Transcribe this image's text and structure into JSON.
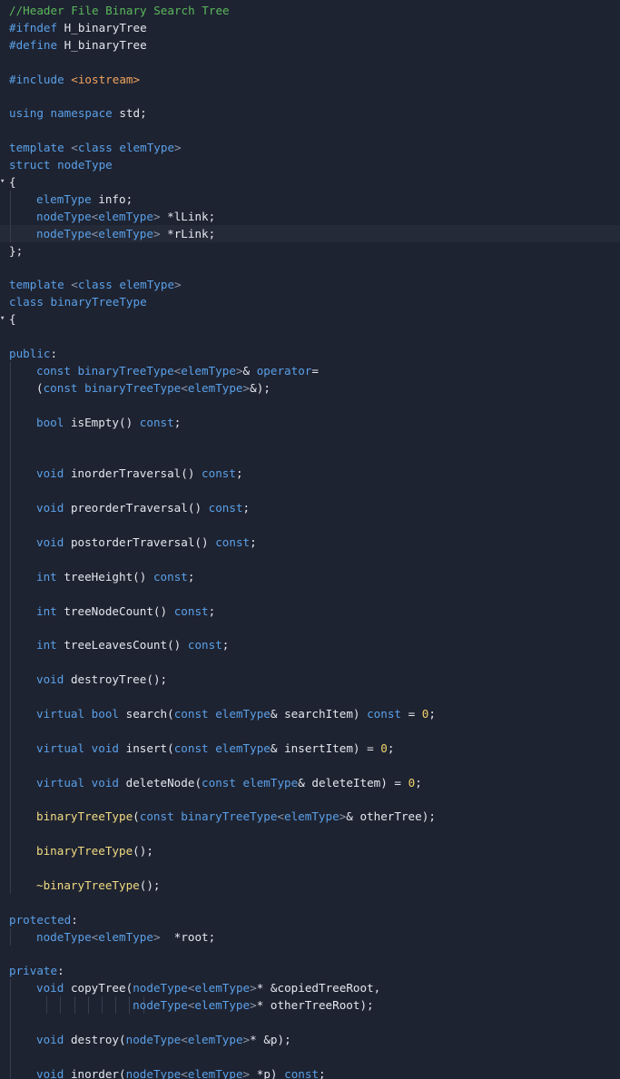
{
  "editor": {
    "lines": [
      {
        "text": "//Header File Binary Search Tree",
        "indent": 0
      },
      {
        "text": "#ifndef H_binaryTree",
        "indent": 0
      },
      {
        "text": "#define H_binaryTree",
        "indent": 0
      },
      {
        "text": "",
        "indent": 0
      },
      {
        "text": "#include <iostream>",
        "indent": 0
      },
      {
        "text": "",
        "indent": 0
      },
      {
        "text": "using namespace std;",
        "indent": 0
      },
      {
        "text": "",
        "indent": 0
      },
      {
        "text": "template <class elemType>",
        "indent": 0
      },
      {
        "text": "struct nodeType",
        "indent": 0
      },
      {
        "text": "{",
        "indent": 0,
        "fold": true
      },
      {
        "text": "elemType info;",
        "indent": 1
      },
      {
        "text": "nodeType<elemType> *lLink;",
        "indent": 1
      },
      {
        "text": "nodeType<elemType> *rLink;",
        "indent": 1,
        "active": true
      },
      {
        "text": "};",
        "indent": 0
      },
      {
        "text": "",
        "indent": 0
      },
      {
        "text": "template <class elemType>",
        "indent": 0
      },
      {
        "text": "class binaryTreeType",
        "indent": 0
      },
      {
        "text": "{",
        "indent": 0,
        "fold": true
      },
      {
        "text": "",
        "indent": 0
      },
      {
        "text": "public:",
        "indent": 0
      },
      {
        "text": "const binaryTreeType<elemType>& operator=",
        "indent": 1
      },
      {
        "text": "(const binaryTreeType<elemType>&);",
        "indent": 1
      },
      {
        "text": "",
        "indent": 1
      },
      {
        "text": "bool isEmpty() const;",
        "indent": 1
      },
      {
        "text": "",
        "indent": 1
      },
      {
        "text": "",
        "indent": 1
      },
      {
        "text": "void inorderTraversal() const;",
        "indent": 1
      },
      {
        "text": "",
        "indent": 1
      },
      {
        "text": "void preorderTraversal() const;",
        "indent": 1
      },
      {
        "text": "",
        "indent": 1
      },
      {
        "text": "void postorderTraversal() const;",
        "indent": 1
      },
      {
        "text": "",
        "indent": 1
      },
      {
        "text": "int treeHeight() const;",
        "indent": 1
      },
      {
        "text": "",
        "indent": 1
      },
      {
        "text": "int treeNodeCount() const;",
        "indent": 1
      },
      {
        "text": "",
        "indent": 1
      },
      {
        "text": "int treeLeavesCount() const;",
        "indent": 1
      },
      {
        "text": "",
        "indent": 1
      },
      {
        "text": "void destroyTree();",
        "indent": 1
      },
      {
        "text": "",
        "indent": 1
      },
      {
        "text": "virtual bool search(const elemType& searchItem) const = 0;",
        "indent": 1
      },
      {
        "text": "",
        "indent": 1
      },
      {
        "text": "virtual void insert(const elemType& insertItem) = 0;",
        "indent": 1
      },
      {
        "text": "",
        "indent": 1
      },
      {
        "text": "virtual void deleteNode(const elemType& deleteItem) = 0;",
        "indent": 1
      },
      {
        "text": "",
        "indent": 1
      },
      {
        "text": "binaryTreeType(const binaryTreeType<elemType>& otherTree);",
        "indent": 1
      },
      {
        "text": "",
        "indent": 1
      },
      {
        "text": "binaryTreeType();",
        "indent": 1
      },
      {
        "text": "",
        "indent": 1
      },
      {
        "text": "~binaryTreeType();",
        "indent": 1
      },
      {
        "text": "",
        "indent": 0
      },
      {
        "text": "protected:",
        "indent": 0
      },
      {
        "text": "nodeType<elemType>  *root;",
        "indent": 1
      },
      {
        "text": "",
        "indent": 0
      },
      {
        "text": "private:",
        "indent": 0
      },
      {
        "text": "void copyTree(nodeType<elemType>* &copiedTreeRoot,",
        "indent": 1
      },
      {
        "text": "              nodeType<elemType>* otherTreeRoot);",
        "indent": 1,
        "extraGuides": [
          8,
          9,
          10,
          11,
          12,
          13,
          14,
          15
        ]
      },
      {
        "text": "",
        "indent": 1
      },
      {
        "text": "void destroy(nodeType<elemType>* &p);",
        "indent": 1
      },
      {
        "text": "",
        "indent": 1
      },
      {
        "text": "void inorder(nodeType<elemType> *p) const;",
        "indent": 1
      }
    ]
  },
  "theme": {
    "background": "#1e2331",
    "active_line": "#242a38",
    "comment": "#5bb85d",
    "keyword": "#5aa0e8",
    "include": "#f0a35e",
    "number": "#f3d36a",
    "function": "#f2dc82",
    "text": "#e4e7ee"
  },
  "icons": {
    "fold_marker": "fold-chevron-icon"
  }
}
